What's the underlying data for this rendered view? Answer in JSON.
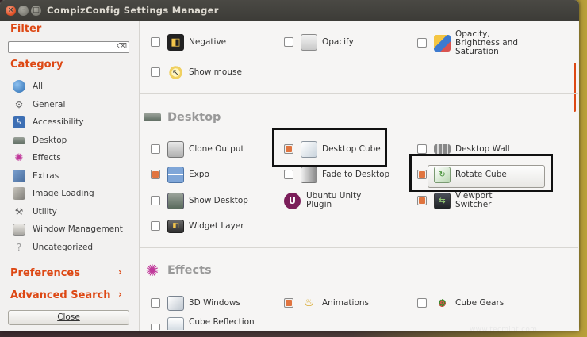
{
  "window": {
    "title": "CompizConfig Settings Manager"
  },
  "sidebar": {
    "filter_heading": "Filter",
    "filter_value": "",
    "category_heading": "Category",
    "categories": [
      {
        "label": "All",
        "icon": "globe-icon"
      },
      {
        "label": "General",
        "icon": "gear-icon"
      },
      {
        "label": "Accessibility",
        "icon": "accessibility-icon"
      },
      {
        "label": "Desktop",
        "icon": "desktop-icon"
      },
      {
        "label": "Effects",
        "icon": "effects-icon"
      },
      {
        "label": "Extras",
        "icon": "extras-icon"
      },
      {
        "label": "Image Loading",
        "icon": "image-loading-icon"
      },
      {
        "label": "Utility",
        "icon": "utility-icon"
      },
      {
        "label": "Window Management",
        "icon": "window-management-icon"
      },
      {
        "label": "Uncategorized",
        "icon": "uncategorized-icon"
      }
    ],
    "preferences": "Preferences",
    "advanced_search": "Advanced Search",
    "close": "Close"
  },
  "plugins": {
    "top": [
      {
        "label": "Negative",
        "checked": false
      },
      {
        "label": "Opacify",
        "checked": false
      },
      {
        "label": "Opacity, Brightness and Saturation",
        "line1": "Opacity,",
        "line2": "Brightness and",
        "line3": "Saturation",
        "checked": false
      },
      {
        "label": "Show mouse",
        "checked": false
      }
    ],
    "desktop_section": "Desktop",
    "desktop": [
      {
        "label": "Clone Output",
        "checked": false
      },
      {
        "label": "Desktop Cube",
        "checked": true
      },
      {
        "label": "Desktop Wall",
        "checked": false
      },
      {
        "label": "Expo",
        "checked": true
      },
      {
        "label": "Fade to Desktop",
        "checked": false
      },
      {
        "label": "Rotate Cube",
        "checked": true
      },
      {
        "label": "Show Desktop",
        "checked": false
      },
      {
        "label": "Ubuntu Unity Plugin",
        "line1": "Ubuntu Unity",
        "line2": "Plugin",
        "checked": false
      },
      {
        "label": "Viewport Switcher",
        "line1": "Viewport",
        "line2": "Switcher",
        "checked": true
      },
      {
        "label": "Widget Layer",
        "checked": false
      }
    ],
    "effects_section": "Effects",
    "effects": [
      {
        "label": "3D Windows",
        "checked": false
      },
      {
        "label": "Animations",
        "checked": true
      },
      {
        "label": "Cube Gears",
        "checked": false
      },
      {
        "label": "Cube Reflection",
        "checked": false
      }
    ]
  },
  "colors": {
    "accent": "#dd4814",
    "check": "#e0743f"
  },
  "watermark": "www.tecmint.com"
}
